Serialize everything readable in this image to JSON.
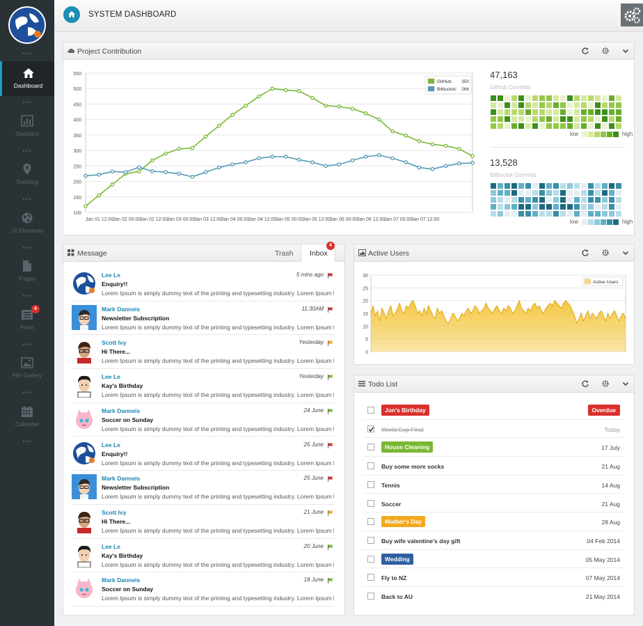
{
  "colors": {
    "github": "#7ab733",
    "bitbucket": "#5598b4",
    "active_users": "#f3c53a",
    "accent": "#1c8fb5",
    "sidebar_bg": "#2b3236"
  },
  "sidebar": {
    "items": [
      {
        "label": "Dashboard",
        "icon": "home-icon"
      },
      {
        "label": "Statistics",
        "icon": "bar-chart-icon"
      },
      {
        "label": "Tracking",
        "icon": "map-marker-icon"
      },
      {
        "label": "UI Elements",
        "icon": "globe-icon"
      },
      {
        "label": "Pages",
        "icon": "file-icon"
      },
      {
        "label": "Form",
        "icon": "list-icon",
        "badge": "4"
      },
      {
        "label": "File Gallery",
        "icon": "image-icon"
      },
      {
        "label": "Calendar",
        "icon": "calendar-icon"
      }
    ]
  },
  "header": {
    "title": "SYSTEM DASHBOARD"
  },
  "contribution": {
    "title": "Project Contribution",
    "github_total": "47,163",
    "github_label": "GitHub Commits",
    "bitbucket_total": "13,528",
    "bitbucket_label": "Bitbucket Commits",
    "legend_low": "low",
    "legend_high": "high"
  },
  "chart_data": [
    {
      "type": "line",
      "x_tick_labels": [
        "Jan 01 12:00",
        "Jan 02 00:00",
        "Jan 02 12:00",
        "Jan 03 00:00",
        "Jan 03 12:00",
        "Jan 04 00:00",
        "Jan 04 12:00",
        "Jan 05 00:00",
        "Jan 05 12:00",
        "Jan 06 00:00",
        "Jan 06 12:00",
        "Jan 07 00:00",
        "Jan 07 12:00"
      ],
      "y_ticks": [
        100,
        150,
        200,
        250,
        300,
        350,
        400,
        450,
        500,
        550
      ],
      "ylim": [
        100,
        550
      ],
      "grid": true,
      "legend_position": "top-right",
      "series": [
        {
          "name": "GitHub",
          "legend_value": "350",
          "values": [
            120,
            155,
            190,
            225,
            232,
            268,
            290,
            305,
            308,
            345,
            380,
            415,
            445,
            475,
            500,
            495,
            492,
            470,
            445,
            442,
            435,
            420,
            400,
            362,
            348,
            330,
            320,
            315,
            305,
            282
          ]
        },
        {
          "name": "Bitbucket",
          "legend_value": "266",
          "values": [
            218,
            222,
            232,
            230,
            246,
            233,
            230,
            225,
            215,
            230,
            245,
            255,
            262,
            275,
            280,
            280,
            270,
            262,
            250,
            255,
            268,
            280,
            285,
            275,
            262,
            245,
            240,
            250,
            258,
            260
          ]
        }
      ]
    },
    {
      "type": "area",
      "legend": "Active Users",
      "y_ticks": [
        0,
        5,
        10,
        15,
        20,
        25,
        30
      ],
      "ylim": [
        0,
        30
      ],
      "grid": true,
      "legend_position": "top-right",
      "values": [
        15,
        18,
        14,
        16,
        12,
        17,
        15,
        13,
        16,
        18,
        14,
        15,
        17,
        19,
        16,
        15,
        18,
        17,
        19,
        20,
        18,
        15,
        16,
        14,
        17,
        15,
        18,
        16,
        14,
        13,
        17,
        15,
        16,
        14,
        12,
        11,
        13,
        15,
        14,
        12,
        13,
        15,
        14,
        16,
        17,
        15,
        16,
        18,
        17,
        15,
        16,
        17,
        19,
        17,
        16,
        15,
        17,
        18,
        16,
        15,
        17,
        16,
        18,
        17,
        15,
        16,
        18,
        20,
        17,
        16,
        15,
        17,
        16,
        18,
        19,
        17,
        18,
        16,
        15,
        17,
        18,
        19,
        18,
        20,
        19,
        18,
        17,
        19,
        20,
        19,
        18,
        16,
        14,
        11,
        13,
        15,
        12,
        14,
        16,
        13,
        15,
        14,
        13,
        15,
        16,
        14,
        12,
        15,
        13,
        15,
        16,
        14,
        12,
        14,
        15,
        13
      ]
    }
  ],
  "messages": {
    "title": "Message",
    "tabs": {
      "trash": "Trash",
      "inbox": "Inbox",
      "inbox_badge": "4"
    },
    "items": [
      {
        "from": "Lee Le",
        "subject": "Enquiry!!",
        "body": "Lorem Ipsum is simply dummy text of the printing and typesetting industry. Lorem Ipsum h...",
        "time": "5 mins ago",
        "flag": "#d9302d",
        "avatar": "shield"
      },
      {
        "from": "Mark Danneis",
        "subject": "Newsletter Subscription",
        "body": "Lorem Ipsum is simply dummy text of the printing and typesetting industry. Lorem Ipsum h...",
        "time": "11:30AM",
        "flag": "#d9302d",
        "avatar": "blue"
      },
      {
        "from": "Scott Ivy",
        "subject": "Hi There...",
        "body": "Lorem Ipsum is simply dummy text of the printing and typesetting industry. Lorem Ipsum h...",
        "time": "Yesterday",
        "flag": "#f0a81e",
        "avatar": "glasses"
      },
      {
        "from": "Lee Le",
        "subject": "Kay's Birthday",
        "body": "Lorem Ipsum is simply dummy text of the printing and typesetting industry. Lorem Ipsum h...",
        "time": "Yesterday",
        "flag": "#7ab733",
        "avatar": "man"
      },
      {
        "from": "Mark Danneis",
        "subject": "Soccer on Sunday",
        "body": "Lorem Ipsum is simply dummy text of the printing and typesetting industry. Lorem Ipsum h...",
        "time": "24 June",
        "flag": "#7ab733",
        "avatar": "pink"
      },
      {
        "from": "Lee Le",
        "subject": "Enquiry!!",
        "body": "Lorem Ipsum is simply dummy text of the printing and typesetting industry. Lorem Ipsum h...",
        "time": "25 June",
        "flag": "#d9302d",
        "avatar": "shield"
      },
      {
        "from": "Mark Danneis",
        "subject": "Newsletter Subscription",
        "body": "Lorem Ipsum is simply dummy text of the printing and typesetting industry. Lorem Ipsum h...",
        "time": "25 June",
        "flag": "#d9302d",
        "avatar": "blue"
      },
      {
        "from": "Scott Ivy",
        "subject": "Hi There...",
        "body": "Lorem Ipsum is simply dummy text of the printing and typesetting industry. Lorem Ipsum h...",
        "time": "21 June",
        "flag": "#f0a81e",
        "avatar": "glasses"
      },
      {
        "from": "Lee Le",
        "subject": "Kay's Birthday",
        "body": "Lorem Ipsum is simply dummy text of the printing and typesetting industry. Lorem Ipsum h...",
        "time": "20 June",
        "flag": "#7ab733",
        "avatar": "man"
      },
      {
        "from": "Mark Danneis",
        "subject": "Soccer on Sunday",
        "body": "Lorem Ipsum is simply dummy text of the printing and typesetting industry. Lorem Ipsum h...",
        "time": "18 June",
        "flag": "#7ab733",
        "avatar": "pink"
      }
    ]
  },
  "active_users": {
    "title": "Active Users"
  },
  "todo": {
    "title": "Todo List",
    "items": [
      {
        "text": "Jon's Birthday",
        "tag_color": "#d9302d",
        "date": "",
        "overdue": "Overdue",
        "checked": false,
        "strike": false
      },
      {
        "text": "World Cup Final",
        "tag_color": "",
        "date": "Today",
        "overdue": "",
        "checked": true,
        "strike": true
      },
      {
        "text": "House Cleaning",
        "tag_color": "#7ab733",
        "date": "17 July",
        "overdue": "",
        "checked": false,
        "strike": false
      },
      {
        "text": "Buy some more socks",
        "tag_color": "",
        "date": "21 Aug",
        "overdue": "",
        "checked": false,
        "strike": false
      },
      {
        "text": "Tennis",
        "tag_color": "",
        "date": "14 Aug",
        "overdue": "",
        "checked": false,
        "strike": false
      },
      {
        "text": "Soccer",
        "tag_color": "",
        "date": "21 Aug",
        "overdue": "",
        "checked": false,
        "strike": false
      },
      {
        "text": "Mother's Day",
        "tag_color": "#f3a81e",
        "date": "28 Aug",
        "overdue": "",
        "checked": false,
        "strike": false
      },
      {
        "text": "Buy wife valentine's day gift",
        "tag_color": "",
        "date": "04 Feb 2014",
        "overdue": "",
        "checked": false,
        "strike": false
      },
      {
        "text": "Wedding",
        "tag_color": "#2f5f9e",
        "date": "05 May 2014",
        "overdue": "",
        "checked": false,
        "strike": false
      },
      {
        "text": "Fly to NZ",
        "tag_color": "",
        "date": "07 May 2014",
        "overdue": "",
        "checked": false,
        "strike": false
      },
      {
        "text": "Back to AU",
        "tag_color": "",
        "date": "21 May 2014",
        "overdue": "",
        "checked": false,
        "strike": false
      }
    ]
  }
}
